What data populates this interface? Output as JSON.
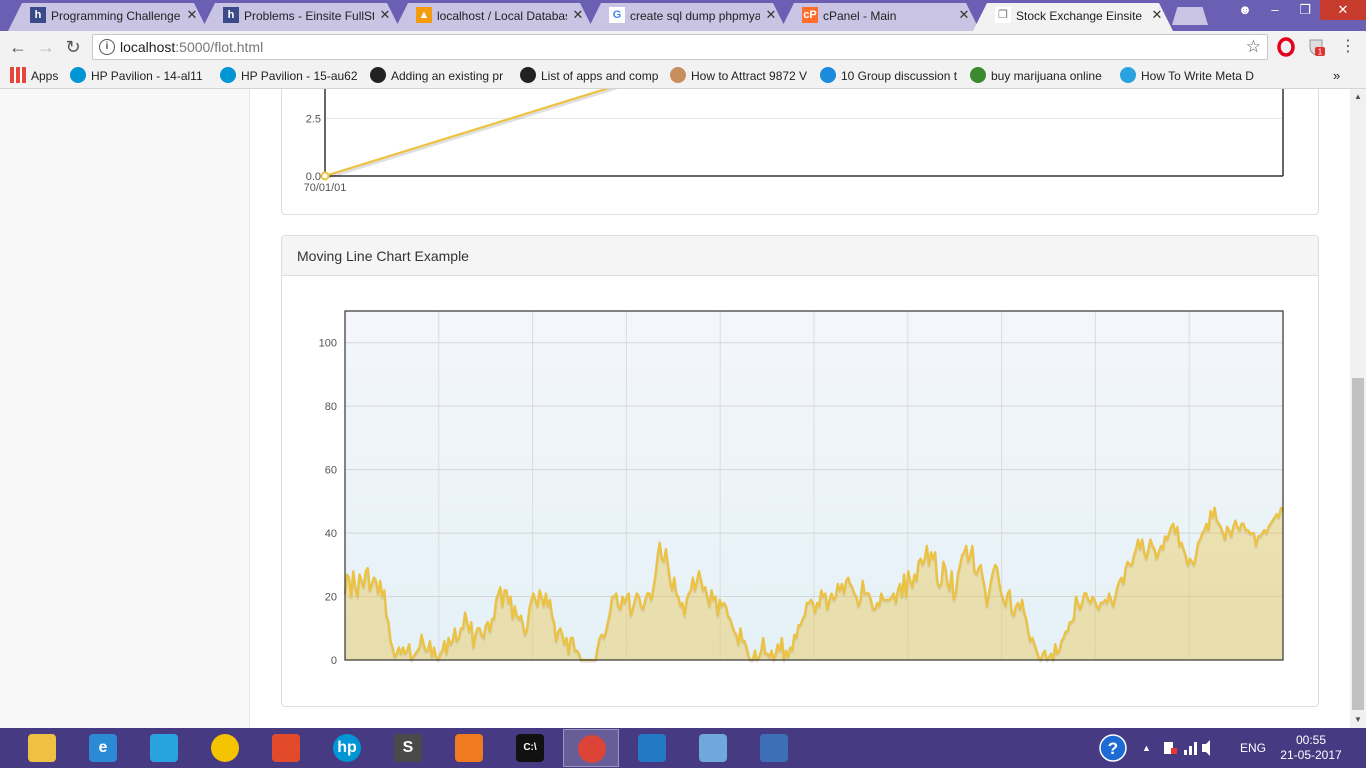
{
  "browser": {
    "tabs": [
      {
        "title": "Programming Challenge",
        "favicon": "h-icon",
        "active": false
      },
      {
        "title": "Problems - Einsite FullSta",
        "favicon": "h-icon",
        "active": false
      },
      {
        "title": "localhost / Local Databas",
        "favicon": "phpmyadmin-icon",
        "active": false
      },
      {
        "title": "create sql dump phpmya",
        "favicon": "google-icon",
        "active": false
      },
      {
        "title": "cPanel - Main",
        "favicon": "cpanel-icon",
        "active": false
      },
      {
        "title": "Stock Exchange Einsite C",
        "favicon": "page-icon",
        "active": true
      }
    ],
    "url_host": "localhost",
    "url_path": ":5000/flot.html",
    "bookmarks": [
      {
        "label": "Apps",
        "icon": "apps-grid-icon"
      },
      {
        "label": "HP Pavilion - 14-al11",
        "icon": "hp-icon"
      },
      {
        "label": "HP Pavilion - 15-au62",
        "icon": "hp-icon"
      },
      {
        "label": "Adding an existing pr",
        "icon": "github-icon"
      },
      {
        "label": "List of apps and comp",
        "icon": "github-icon"
      },
      {
        "label": "How to Attract 9872 V",
        "icon": "avatar-icon"
      },
      {
        "label": "10 Group discussion t",
        "icon": "discussion-icon"
      },
      {
        "label": "buy marijuana online",
        "icon": "leaf-icon"
      },
      {
        "label": "How To Write Meta D",
        "icon": "page-blue-icon"
      }
    ],
    "bookmarks_overflow": "»"
  },
  "panels": {
    "top": {
      "title": ""
    },
    "moving": {
      "title": "Moving Line Chart Example"
    }
  },
  "chart_data": [
    {
      "type": "line",
      "title": "",
      "x_tick_labels": [
        "70/01/01"
      ],
      "y_tick_labels": [
        "0.0",
        "2.5"
      ],
      "visible_ylim": [
        0,
        4.6
      ],
      "series": [
        {
          "color": "#edc240",
          "x": [
            0,
            1
          ],
          "y": [
            0,
            4.6
          ]
        }
      ],
      "grid": true,
      "note_clipped_top": true
    },
    {
      "type": "area",
      "title": "",
      "xlim": [
        0,
        299
      ],
      "ylim": [
        0,
        110
      ],
      "y_ticks": [
        0,
        20,
        40,
        60,
        80,
        100
      ],
      "x_gridlines": 10,
      "grid": true,
      "series": [
        {
          "color": "#edc240",
          "fill": true,
          "values": [
            21,
            27,
            26,
            20,
            28,
            23,
            20,
            27,
            25,
            23,
            28,
            29,
            22,
            24,
            26,
            25,
            21,
            25,
            20,
            22,
            14,
            12,
            6,
            4,
            1,
            2,
            4,
            2,
            4,
            2,
            3,
            5,
            0,
            1,
            2,
            3,
            4,
            8,
            5,
            3,
            3,
            6,
            1,
            4,
            1,
            0,
            2,
            3,
            6,
            2,
            7,
            5,
            6,
            10,
            6,
            7,
            10,
            10,
            15,
            12,
            9,
            12,
            4,
            8,
            10,
            10,
            8,
            7,
            11,
            12,
            9,
            13,
            13,
            19,
            21,
            23,
            17,
            22,
            22,
            18,
            20,
            13,
            17,
            14,
            13,
            14,
            11,
            8,
            10,
            16,
            19,
            21,
            19,
            17,
            22,
            20,
            17,
            21,
            17,
            19,
            14,
            12,
            6,
            9,
            10,
            8,
            5,
            7,
            2,
            7,
            7,
            3,
            3,
            2,
            0,
            0,
            0,
            0,
            0,
            0,
            0,
            0,
            4,
            7,
            8,
            7,
            9,
            12,
            15,
            20,
            20,
            21,
            17,
            16,
            20,
            18,
            20,
            21,
            14,
            16,
            19,
            21,
            20,
            17,
            16,
            19,
            21,
            21,
            19,
            23,
            27,
            33,
            37,
            32,
            31,
            35,
            30,
            25,
            22,
            26,
            21,
            20,
            17,
            18,
            14,
            19,
            21,
            22,
            26,
            22,
            25,
            28,
            25,
            22,
            23,
            20,
            17,
            22,
            19,
            20,
            14,
            19,
            17,
            18,
            17,
            14,
            13,
            11,
            9,
            8,
            5,
            10,
            6,
            6,
            4,
            1,
            0,
            0,
            3,
            0,
            1,
            3,
            7,
            2,
            2,
            1,
            3,
            0,
            2,
            5,
            3,
            7,
            0,
            3,
            1,
            4,
            3,
            8,
            7,
            11,
            11,
            13,
            14,
            18,
            18,
            19,
            18,
            15,
            18,
            17,
            22,
            20,
            21,
            16,
            19,
            21,
            19,
            20,
            24,
            22,
            24,
            21,
            25,
            26,
            24,
            23,
            21,
            20,
            17,
            19,
            25,
            21,
            21,
            21,
            19,
            16,
            16,
            18,
            17,
            21,
            19,
            19,
            19,
            19,
            20,
            21,
            18,
            22,
            24,
            20,
            27,
            20,
            28,
            25,
            23,
            27,
            25,
            31,
            32,
            30,
            32,
            36,
            30,
            34,
            32,
            34,
            25,
            23,
            24,
            31,
            29,
            24,
            22,
            28,
            19,
            21,
            27,
            30,
            33,
            34,
            36,
            31,
            33,
            36,
            28,
            27,
            29,
            30,
            26,
            23,
            17,
            21,
            25,
            28,
            30,
            29,
            24,
            21,
            19,
            17,
            21,
            22,
            15,
            14,
            17,
            18,
            16,
            19,
            15,
            13,
            9,
            6,
            7,
            5,
            3,
            1,
            0,
            2,
            3,
            0,
            1,
            2,
            0,
            5,
            2,
            3,
            6,
            7,
            9,
            9,
            12,
            12,
            13,
            20,
            18,
            16,
            18,
            21,
            21,
            19,
            18,
            20,
            19,
            17,
            16,
            18,
            18,
            19,
            18,
            21,
            19,
            17,
            20,
            23,
            25,
            26,
            24,
            29,
            31,
            30,
            30,
            33,
            35,
            38,
            35,
            38,
            34,
            32,
            35,
            38,
            36,
            35,
            32,
            34,
            36,
            35,
            39,
            38,
            40,
            42,
            43,
            40,
            42,
            36,
            37,
            35,
            33,
            30,
            32,
            31,
            30,
            33,
            37,
            38,
            40,
            41,
            43,
            41,
            47,
            45,
            48,
            44,
            43,
            42,
            40,
            38,
            42,
            41,
            39,
            42,
            44,
            42,
            41,
            43,
            43,
            41,
            41,
            40,
            40,
            40,
            36,
            39,
            39,
            40,
            41,
            40,
            42,
            43,
            44,
            45,
            46,
            45,
            48,
            47
          ]
        }
      ]
    }
  ],
  "taskbar": {
    "apps": [
      {
        "name": "file-explorer-icon",
        "color": "#f0c040",
        "glyph": ""
      },
      {
        "name": "internet-explorer-icon",
        "color": "#2a8ad4",
        "glyph": "e"
      },
      {
        "name": "rocket-app-icon",
        "color": "#29a3e0",
        "glyph": ""
      },
      {
        "name": "media-disc-icon",
        "color": "#f5c400",
        "glyph": ""
      },
      {
        "name": "paint-app-icon",
        "color": "#e24a2b",
        "glyph": ""
      },
      {
        "name": "hp-app-icon",
        "color": "#0096d6",
        "glyph": "hp"
      },
      {
        "name": "sublime-text-icon",
        "color": "#4a4a4a",
        "glyph": "S"
      },
      {
        "name": "media-player-icon",
        "color": "#f07a20",
        "glyph": ""
      },
      {
        "name": "command-prompt-icon",
        "color": "#111111",
        "glyph": "C:\\"
      },
      {
        "name": "chrome-icon",
        "color": "#db4437",
        "glyph": ""
      },
      {
        "name": "visual-studio-icon",
        "color": "#2479c4",
        "glyph": ""
      },
      {
        "name": "resource-monitor-icon",
        "color": "#6fa8dc",
        "glyph": ""
      },
      {
        "name": "reader-app-icon",
        "color": "#3d6fb6",
        "glyph": ""
      }
    ],
    "language": "ENG",
    "time": "00:55",
    "date": "21-05-2017"
  }
}
